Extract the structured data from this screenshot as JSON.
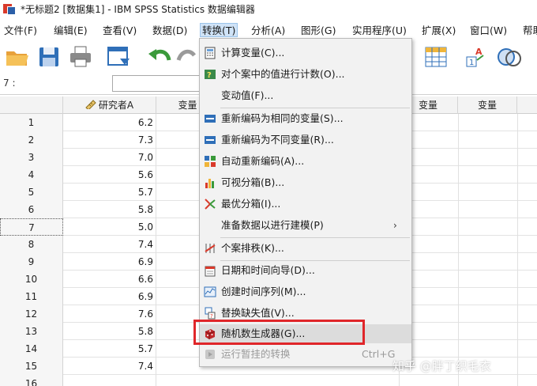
{
  "window": {
    "title": "*无标题2 [数据集1] - IBM SPSS Statistics 数据编辑器"
  },
  "menubar": {
    "items": [
      {
        "label": "文件(F)"
      },
      {
        "label": "编辑(E)"
      },
      {
        "label": "查看(V)"
      },
      {
        "label": "数据(D)"
      },
      {
        "label": "转换(T)"
      },
      {
        "label": "分析(A)"
      },
      {
        "label": "图形(G)"
      },
      {
        "label": "实用程序(U)"
      },
      {
        "label": "扩展(X)"
      },
      {
        "label": "窗口(W)"
      },
      {
        "label": "帮助"
      }
    ],
    "active_index": 4
  },
  "toolbar": {
    "icons": [
      "open-folder-icon",
      "save-icon",
      "print-icon",
      "dialog-recall-icon",
      "undo-icon",
      "redo-icon",
      "grid-icon",
      "value-labels-icon",
      "venn-icon"
    ]
  },
  "cell_editor": {
    "reference": "7 :",
    "value": ""
  },
  "grid": {
    "columns": [
      {
        "label": "研究者A",
        "icon": "ruler-icon"
      },
      {
        "label": "变量"
      },
      {
        "label": "变量"
      },
      {
        "label": "变量"
      }
    ],
    "rows": [
      {
        "num": "1",
        "value": "6.2"
      },
      {
        "num": "2",
        "value": "7.3"
      },
      {
        "num": "3",
        "value": "7.0"
      },
      {
        "num": "4",
        "value": "5.6"
      },
      {
        "num": "5",
        "value": "5.7"
      },
      {
        "num": "6",
        "value": "5.8"
      },
      {
        "num": "7",
        "value": "5.0"
      },
      {
        "num": "8",
        "value": "7.4"
      },
      {
        "num": "9",
        "value": "6.9"
      },
      {
        "num": "10",
        "value": "6.6"
      },
      {
        "num": "11",
        "value": "6.9"
      },
      {
        "num": "12",
        "value": "7.6"
      },
      {
        "num": "13",
        "value": "5.8"
      },
      {
        "num": "14",
        "value": "5.7"
      },
      {
        "num": "15",
        "value": "7.4"
      },
      {
        "num": "16",
        "value": ""
      }
    ],
    "selected_row": "7"
  },
  "dropdown": {
    "items": [
      {
        "label": "计算变量(C)...",
        "icon": "calculator-icon"
      },
      {
        "label": "对个案中的值进行计数(O)...",
        "icon": "count-values-icon"
      },
      {
        "label": "变动值(F)...",
        "icon": ""
      },
      {
        "label": "重新编码为相同的变量(S)...",
        "icon": "recode-same-icon"
      },
      {
        "label": "重新编码为不同变量(R)...",
        "icon": "recode-different-icon"
      },
      {
        "label": "自动重新编码(A)...",
        "icon": "automatic-recode-icon"
      },
      {
        "label": "可视分箱(B)...",
        "icon": "visual-binning-icon"
      },
      {
        "label": "最优分箱(I)...",
        "icon": "optimal-binning-icon"
      },
      {
        "label": "准备数据以进行建模(P)",
        "icon": "",
        "submenu": true
      },
      {
        "label": "个案排秩(K)...",
        "icon": "rank-cases-icon"
      },
      {
        "label": "日期和时间向导(D)...",
        "icon": "date-time-icon"
      },
      {
        "label": "创建时间序列(M)...",
        "icon": "time-series-icon"
      },
      {
        "label": "替换缺失值(V)...",
        "icon": "replace-missing-icon"
      },
      {
        "label": "随机数生成器(G)...",
        "icon": "dice-icon",
        "highlighted": true
      },
      {
        "label": "运行暂挂的转换",
        "icon": "run-pending-icon",
        "disabled": true,
        "shortcut": "Ctrl+G"
      }
    ]
  },
  "watermark": {
    "text": "知乎 @胖丁织毛衣"
  },
  "colors": {
    "highlight_box": "#e0262a",
    "menu_active": "#cfe3f7"
  }
}
